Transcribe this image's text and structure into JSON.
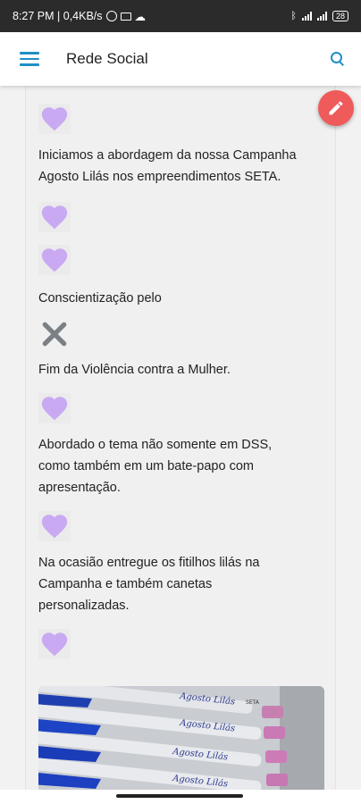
{
  "statusbar": {
    "time_speed": "8:27 PM | 0,4KB/s",
    "battery": "28"
  },
  "appbar": {
    "title": "Rede Social"
  },
  "post": {
    "lines": [
      "Iniciamos a abordagem da nossa Campanha",
      "Agosto Lilás nos empreendimentos SETA.",
      "Conscientização pelo",
      "Fim da Violência contra a Mulher.",
      "Abordado o tema não somente em DSS,",
      "como também em um bate-papo com",
      "apresentação.",
      "Na ocasião entregue os fitilhos lilás na",
      "Campanha e também canetas",
      "personalizadas."
    ],
    "photo_label": "Agosto Lilás",
    "photo_label_small": "SETA"
  },
  "colors": {
    "accent": "#1f8fc7",
    "heart": "#c9a9f2",
    "fab": "#ef5a5a"
  }
}
